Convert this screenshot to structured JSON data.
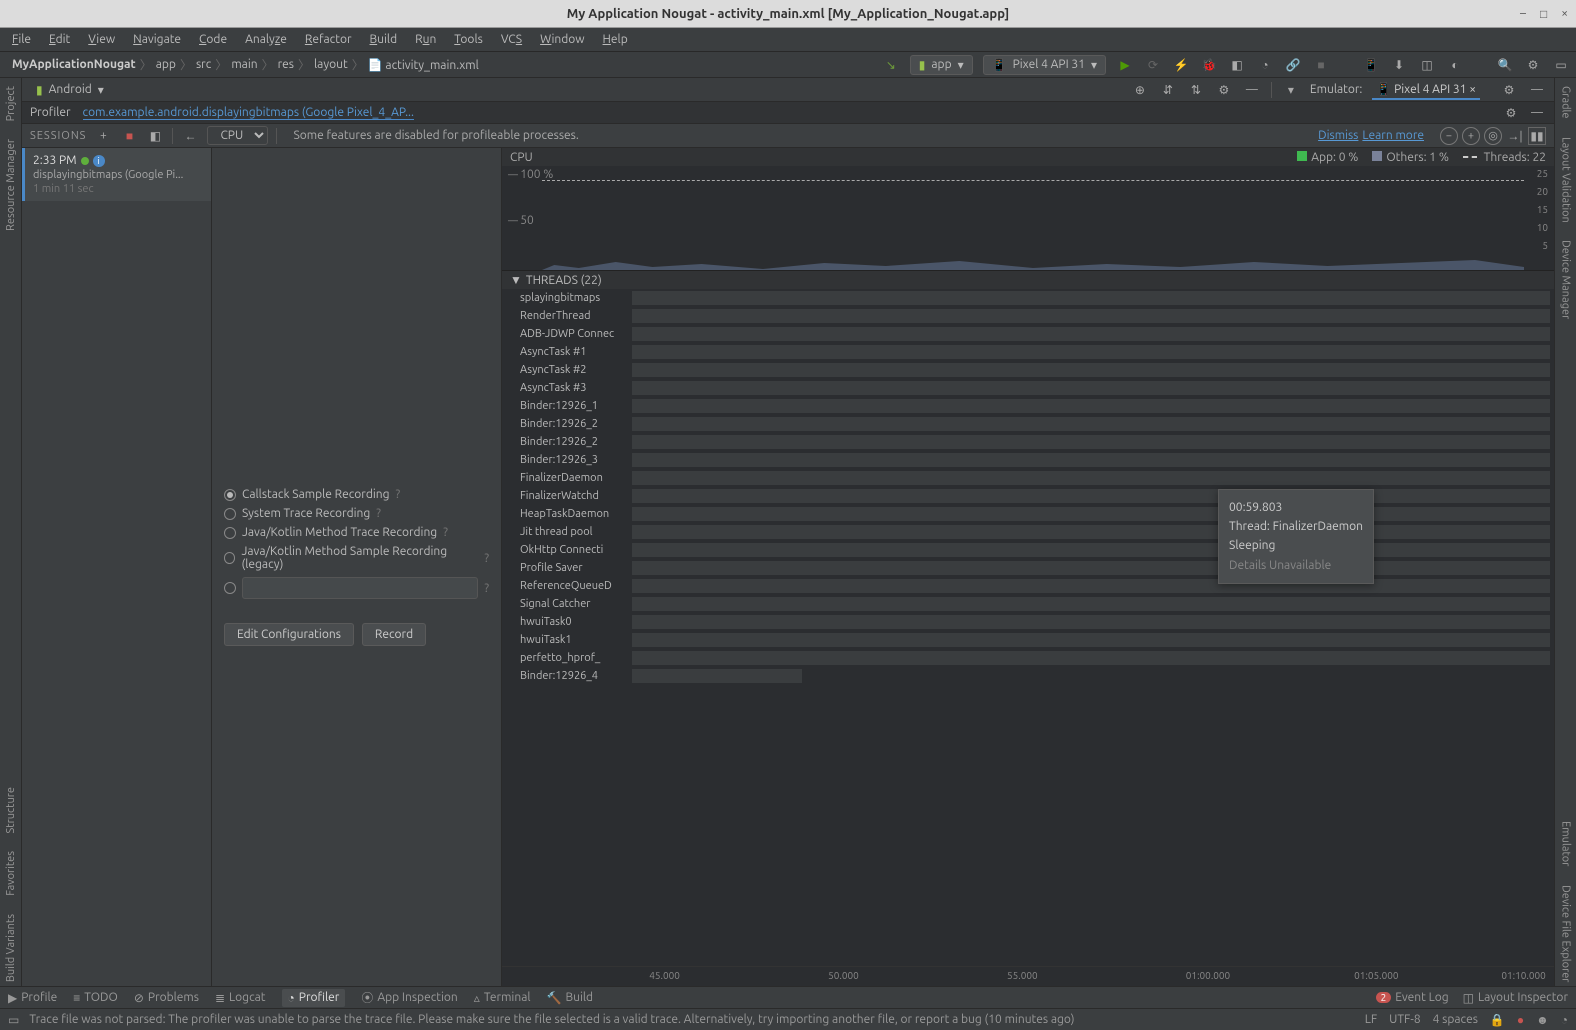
{
  "window": {
    "title": "My Application Nougat - activity_main.xml [My_Application_Nougat.app]",
    "min": "–",
    "max": "□",
    "close": "×"
  },
  "menu": [
    "File",
    "Edit",
    "View",
    "Navigate",
    "Code",
    "Analyze",
    "Refactor",
    "Build",
    "Run",
    "Tools",
    "VCS",
    "Window",
    "Help"
  ],
  "breadcrumbs": [
    "MyApplicationNougat",
    "app",
    "src",
    "main",
    "res",
    "layout",
    "activity_main.xml"
  ],
  "run_config": {
    "app": "app",
    "device": "Pixel 4 API 31"
  },
  "tool_window": {
    "view": "Android"
  },
  "emulator": {
    "label": "Emulator:",
    "tab": "Pixel 4 API 31"
  },
  "left_gutter": [
    "Project",
    "Resource Manager",
    "Structure",
    "Favorites",
    "Build Variants"
  ],
  "right_gutter": [
    "Gradle",
    "Layout Validation",
    "Device Manager",
    "Emulator",
    "Device File Explorer"
  ],
  "profiler_header": {
    "title": "Profiler",
    "process": "com.example.android.displayingbitmaps (Google Pixel_4_AP..."
  },
  "sessions": {
    "label": "SESSIONS",
    "dropdown": "CPU",
    "warning": "Some features are disabled for profileable processes.",
    "dismiss": "Dismiss",
    "learn": "Learn more",
    "item": {
      "time": "2:33 PM",
      "name": "displayingbitmaps (Google Pi...",
      "duration": "1 min 11 sec"
    }
  },
  "config": {
    "options": [
      "Callstack Sample Recording",
      "System Trace Recording",
      "Java/Kotlin Method Trace Recording",
      "Java/Kotlin Method Sample Recording (legacy)"
    ],
    "edit": "Edit Configurations",
    "record": "Record"
  },
  "cpu": {
    "title": "CPU",
    "legend": {
      "app": "App: 0 %",
      "others": "Others: 1 %",
      "threads": "Threads: 22"
    },
    "ylabels": {
      "top": "100 %",
      "mid": "50"
    },
    "yticks": [
      "25",
      "20",
      "15",
      "10",
      "5"
    ]
  },
  "threads_header": "THREADS (22)",
  "threads": [
    "splayingbitmaps",
    "RenderThread",
    "ADB-JDWP Connec",
    "AsyncTask #1",
    "AsyncTask #2",
    "AsyncTask #3",
    "Binder:12926_1",
    "Binder:12926_2",
    "Binder:12926_2",
    "Binder:12926_3",
    "FinalizerDaemon",
    "FinalizerWatchd",
    "HeapTaskDaemon",
    "Jit thread pool",
    "OkHttp Connecti",
    "Profile Saver",
    "ReferenceQueueD",
    "Signal Catcher",
    "hwuiTask0",
    "hwuiTask1",
    "perfetto_hprof_",
    "Binder:12926_4"
  ],
  "tooltip": {
    "time": "00:59.803",
    "thread": "Thread: FinalizerDaemon",
    "state": "Sleeping",
    "detail": "Details Unavailable"
  },
  "time_axis": [
    "45.000",
    "50.000",
    "55.000",
    "01:00.000",
    "01:05.000",
    "01:10.000"
  ],
  "chart_data": {
    "type": "line",
    "title": "CPU",
    "ylabel": "%",
    "ylim": [
      0,
      100
    ],
    "x_range_seconds": [
      42,
      72
    ],
    "series": [
      {
        "name": "App",
        "approx_constant": 0
      },
      {
        "name": "Others",
        "approx_constant": 1
      },
      {
        "name": "Threads",
        "approx_constant": 22
      }
    ],
    "note": "Area chart baseline near 0% with minor spikes up to ~5%; thread count constant at 22."
  },
  "bottom_tabs": {
    "items": [
      "Profile",
      "TODO",
      "Problems",
      "Logcat",
      "Profiler",
      "App Inspection",
      "Terminal",
      "Build"
    ],
    "event_log": "Event Log",
    "event_badge": "2",
    "layout_inspector": "Layout Inspector"
  },
  "status": {
    "msg": "Trace file was not parsed: The profiler was unable to parse the trace file. Please make sure the file selected is a valid trace. Alternatively, try importing another file, or report a bug (10 minutes ago)",
    "lf": "LF",
    "enc": "UTF-8",
    "indent": "4 spaces"
  }
}
